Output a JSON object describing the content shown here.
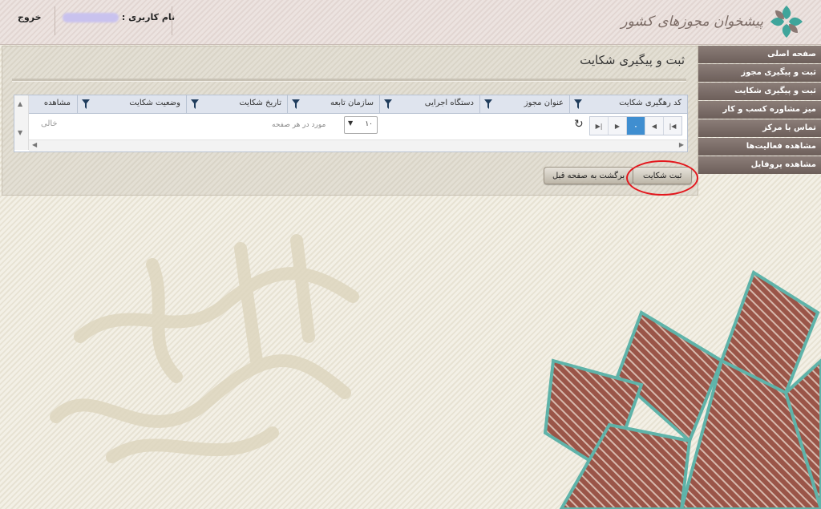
{
  "header": {
    "logout_label": "خروج",
    "username_label": "نام کاربری :",
    "logo_text": "پیشخوان مجوزهای کشور"
  },
  "panel": {
    "title": "ثبت و پیگیری شکایت",
    "grid": {
      "columns": [
        {
          "label": "کد رهگیری شکایت"
        },
        {
          "label": "عنوان مجوز"
        },
        {
          "label": "دستگاه اجرایی"
        },
        {
          "label": "سازمان تابعه"
        },
        {
          "label": "تاریخ شکایت"
        },
        {
          "label": "وضعیت شکایت"
        },
        {
          "label": "مشاهده"
        }
      ],
      "empty_text": "خالی",
      "per_page_label": "مورد در هر صفحه",
      "per_page_value": "۱۰",
      "current_page": "۰"
    },
    "buttons": {
      "submit_label": "ثبت شکایت",
      "back_label": "برگشت به صفحه قبل"
    }
  },
  "sidebar": {
    "items": [
      {
        "label": "صفحه اصلی"
      },
      {
        "label": "ثبت و پیگیری مجوز"
      },
      {
        "label": "ثبت و پیگیری شکایت"
      },
      {
        "label": "میز مشاوره کسب و کار"
      },
      {
        "label": "تماس با مرکز"
      },
      {
        "label": "مشاهده فعالیت‌ها"
      },
      {
        "label": "مشاهده پروفایل"
      }
    ]
  },
  "colors": {
    "menu_bg": "#7c6e69",
    "pager_active": "#3f8ed0",
    "highlight_circle": "#e3181e"
  },
  "icons": [
    "filter-icon",
    "refresh-icon",
    "first-page-icon",
    "prev-page-icon",
    "next-page-icon",
    "last-page-icon",
    "dropdown-arrow-icon",
    "logo-icon"
  ]
}
